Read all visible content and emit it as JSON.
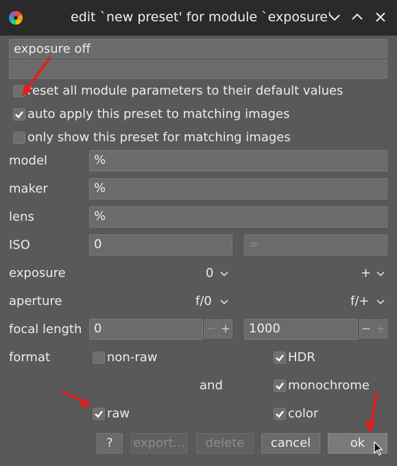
{
  "window": {
    "title": "edit `new preset' for module `exposure'"
  },
  "fields": {
    "name_value": "exposure off",
    "description_value": ""
  },
  "options": {
    "reset_label": "reset all module parameters to their default values",
    "autoapply_label": "auto apply this preset to matching images",
    "filter_label": "only show this preset for matching images"
  },
  "rows": {
    "model_label": "model",
    "model_value": "%",
    "maker_label": "maker",
    "maker_value": "%",
    "lens_label": "lens",
    "lens_value": "%",
    "iso_label": "ISO",
    "iso_min": "0",
    "iso_max": "∞",
    "exposure_label": "exposure",
    "exposure_min": "0",
    "exposure_max": "+",
    "aperture_label": "aperture",
    "aperture_min": "f/0",
    "aperture_max": "f/+",
    "focal_label": "focal length",
    "focal_min": "0",
    "focal_max": "1000",
    "minus": "−",
    "plus": "+"
  },
  "format": {
    "label": "format",
    "nonraw": "non-raw",
    "hdr": "HDR",
    "and": "and",
    "monochrome": "monochrome",
    "raw": "raw",
    "color": "color"
  },
  "buttons": {
    "help": "?",
    "export": "export...",
    "delete": "delete",
    "cancel": "cancel",
    "ok": "ok"
  },
  "colors": {
    "titlebar": "#2a2a2a",
    "dialog": "#595959",
    "annotation_arrow": "#e02020"
  },
  "checked": {
    "reset": false,
    "autoapply": true,
    "filter": false,
    "nonraw": false,
    "hdr": true,
    "monochrome": true,
    "raw": true,
    "color": true
  }
}
